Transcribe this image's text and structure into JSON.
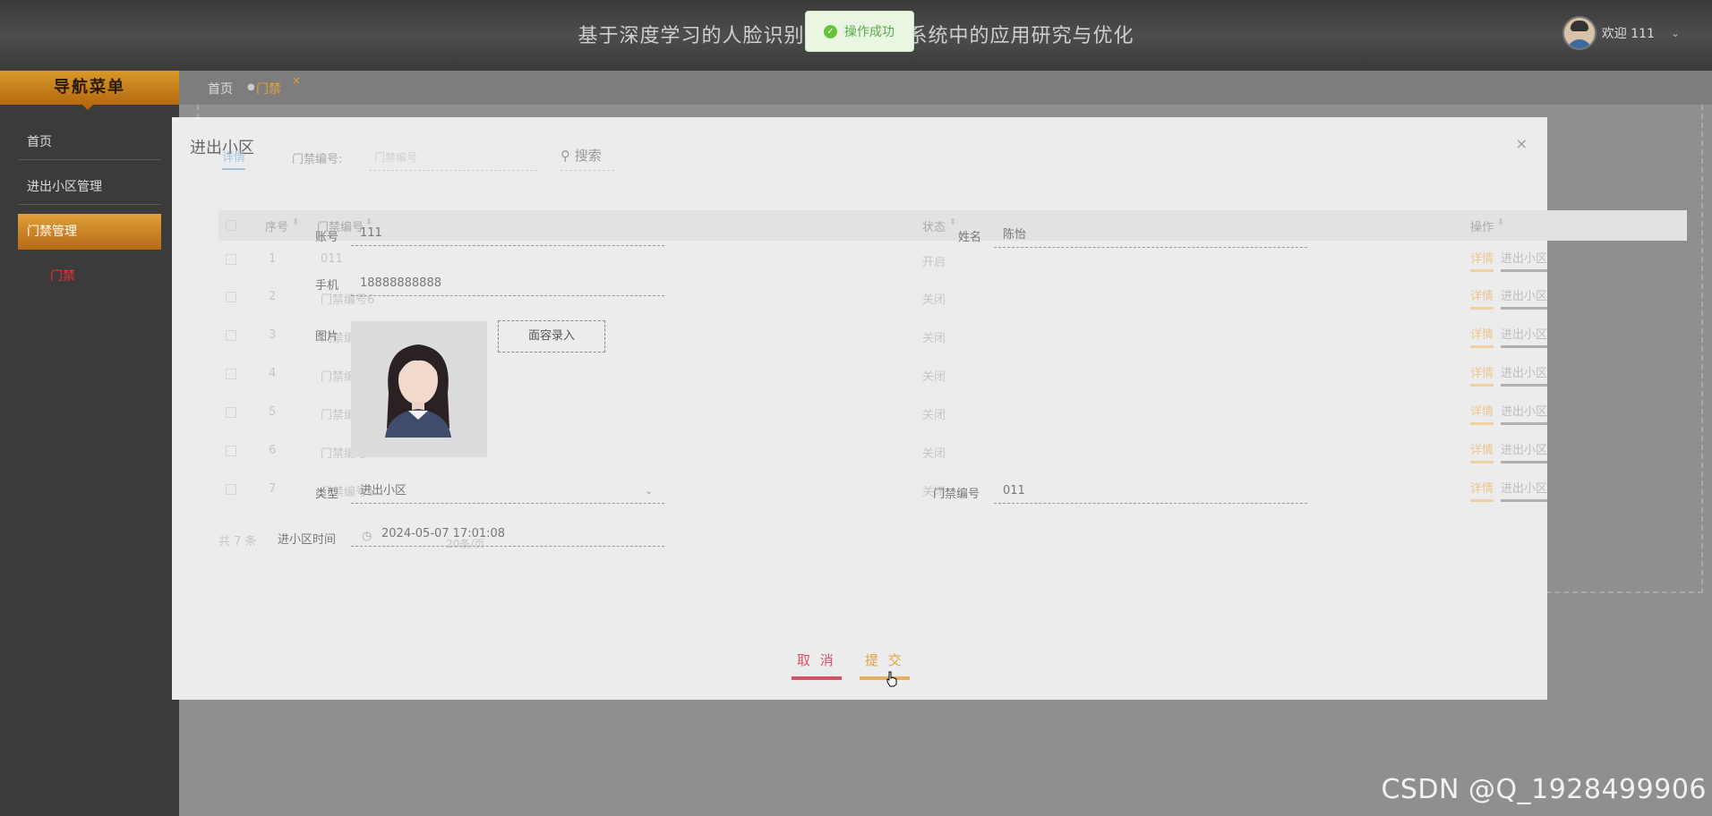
{
  "header": {
    "title": "基于深度学习的人脸识别技术在门禁系统中的应用研究与优化",
    "welcome": "欢迎 111"
  },
  "toast": {
    "message": "操作成功"
  },
  "sidebar": {
    "title": "导航菜单",
    "items": [
      {
        "label": "首页"
      },
      {
        "label": "进出小区管理"
      },
      {
        "label": "门禁管理"
      }
    ],
    "sub_item": "门禁"
  },
  "breadcrumb": {
    "home": "首页",
    "current": "门禁"
  },
  "modal": {
    "title": "进出小区",
    "fields": {
      "account_label": "账号",
      "account_value": "111",
      "name_label": "姓名",
      "name_value": "陈怡",
      "phone_label": "手机",
      "phone_value": "18888888888",
      "photo_label": "图片",
      "face_button": "面容录入",
      "type_label": "类型",
      "type_value": "进出小区",
      "gate_label": "门禁编号",
      "gate_value": "011",
      "time_label": "进小区时间",
      "time_value": "2024-05-07 17:01:08"
    },
    "cancel": "取 消",
    "submit": "提 交"
  },
  "background_table": {
    "tab": "详情",
    "search_label": "门禁编号:",
    "search_placeholder": "门禁编号",
    "search_button": "搜索",
    "columns": [
      "序号",
      "门禁编号",
      "状态",
      "操作"
    ],
    "rows": [
      {
        "index": "1",
        "code": "011",
        "status": "开启"
      },
      {
        "index": "2",
        "code": "门禁编号6",
        "status": "关闭"
      },
      {
        "index": "3",
        "code": "门禁编号5",
        "status": "关闭"
      },
      {
        "index": "4",
        "code": "门禁编号4",
        "status": "关闭"
      },
      {
        "index": "5",
        "code": "门禁编号3",
        "status": "关闭"
      },
      {
        "index": "6",
        "code": "门禁编号2",
        "status": "关闭"
      },
      {
        "index": "7",
        "code": "门禁编号1",
        "status": "关闭"
      }
    ],
    "action_detail": "详情",
    "action_enter": "进出小区",
    "total": "共 7 条",
    "page_size": "20条/页"
  },
  "watermark": "CSDN @Q_1928499906",
  "colors": {
    "accent": "#e6a03a",
    "danger": "#d9506a",
    "success": "#67c23a"
  }
}
